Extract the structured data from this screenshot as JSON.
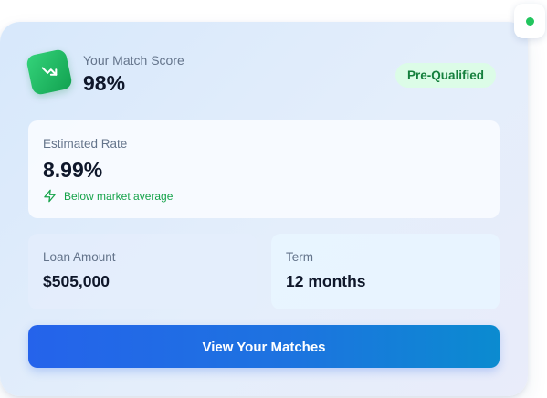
{
  "header": {
    "score_label": "Your Match Score",
    "score_value": "98%",
    "badge": "Pre-Qualified",
    "icon": "trending-down-icon"
  },
  "rate": {
    "label": "Estimated Rate",
    "value": "8.99%",
    "note": "Below market average",
    "note_icon": "lightning-icon"
  },
  "loan": {
    "label": "Loan Amount",
    "value": "$505,000"
  },
  "term": {
    "label": "Term",
    "value": "12 months"
  },
  "cta": {
    "label": "View Your Matches"
  },
  "status": {
    "indicator": "online",
    "color": "#22c55e"
  },
  "colors": {
    "accent": "#2563eb",
    "success": "#16a34a",
    "badge_bg": "#dcfce7",
    "text_primary": "#0f172a",
    "text_muted": "#64748b"
  }
}
